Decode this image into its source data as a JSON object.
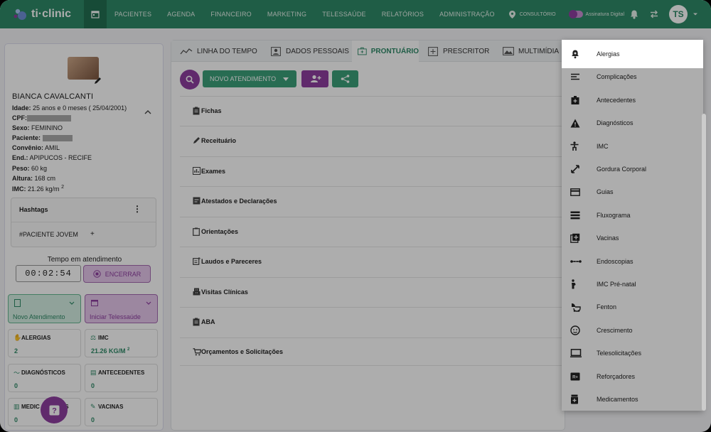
{
  "app": {
    "name": "ti·clinic"
  },
  "nav": [
    "PACIENTES",
    "AGENDA",
    "FINANCEIRO",
    "MARKETING",
    "TELESSAÚDE",
    "RELATÓRIOS",
    "ADMINISTRAÇÃO"
  ],
  "topbar": {
    "location": "CONSULTÓRIO",
    "signature": "Assinatura Digital",
    "avatar": "TS"
  },
  "patient": {
    "name": "BIANCA CAVALCANTI",
    "idade_label": "Idade:",
    "idade": "25 anos e 0 meses ( 25/04/2001)",
    "cpf_label": "CPF:",
    "sexo_label": "Sexo:",
    "sexo": "FEMININO",
    "paciente_label": "Paciente:",
    "convenio_label": "Convênio:",
    "convenio": "AMIL",
    "end_label": "End.:",
    "end": "APIPUCOS -  RECIFE",
    "peso_label": "Peso:",
    "peso": "60 kg",
    "altura_label": "Altura:",
    "altura": "168 cm",
    "imc_label": "IMC:",
    "imc": "21.26 kg/m",
    "imc_sup": "2"
  },
  "hashtags": {
    "title": "Hashtags",
    "tag": "#PACIENTE JOVEM",
    "add": "+"
  },
  "timer": {
    "label": "Tempo em atendimento",
    "value": "00:02:54",
    "stop": "ENCERRAR"
  },
  "actions": {
    "novo": "Novo Atendimento",
    "tele": "Iniciar Telessaúde"
  },
  "stats": [
    {
      "title": "ALERGIAS",
      "value": "2"
    },
    {
      "title": "IMC",
      "value": "21.26 KG/M",
      "sup": "2"
    },
    {
      "title": "DIAGNÓSTICOS",
      "value": "0"
    },
    {
      "title": "ANTECEDENTES",
      "value": "0"
    },
    {
      "title": "MEDIC",
      "title2": "OS",
      "value": "0"
    },
    {
      "title": "VACINAS",
      "value": "0"
    }
  ],
  "tabs": [
    "LINHA DO TEMPO",
    "DADOS PESSOAIS",
    "PRONTUÁRIO",
    "PRESCRITOR",
    "MULTIMÍDIA"
  ],
  "toolbar": {
    "novo": "NOVO ATENDIMENTO"
  },
  "sections": [
    "Fichas",
    "Receituário",
    "Exames",
    "Atestados e Declarações",
    "Orientações",
    "Laudos e Pareceres",
    "Visitas Clínicas",
    "ABA",
    "Orçamentos e Solicitações"
  ],
  "menu": [
    "Alergias",
    "Complicações",
    "Antecedentes",
    "Diagnósticos",
    "IMC",
    "Gordura Corporal",
    "Guias",
    "Fluxograma",
    "Vacinas",
    "Endoscopias",
    "IMC Pré-natal",
    "Fenton",
    "Crescimento",
    "Telesolicitações",
    "Reforçadores",
    "Medicamentos"
  ],
  "colors": {
    "brand": "#2f8a67",
    "accent": "#8e3ea0"
  }
}
